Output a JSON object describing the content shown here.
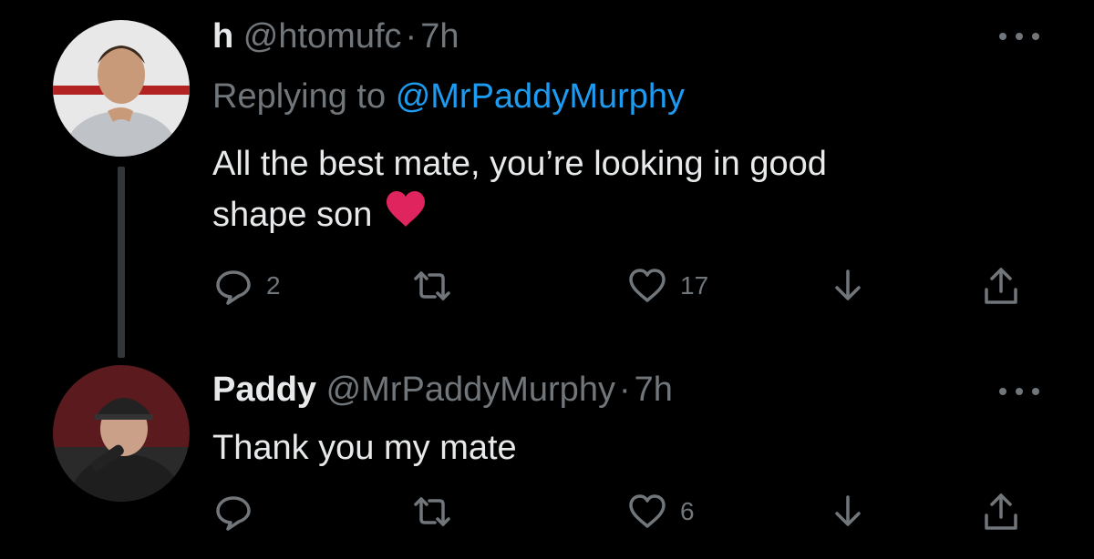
{
  "tweet1": {
    "display_name": "h",
    "handle": "@htomufc",
    "separator": "·",
    "time": "7h",
    "replying_prefix": "Replying to",
    "replying_to": "@MrPaddyMurphy",
    "text_line1": "All the best mate, you’re looking in good",
    "text_line2": "shape son",
    "emoji": "red-heart",
    "reply_count": "2",
    "retweet_count": "",
    "like_count": "17"
  },
  "tweet2": {
    "display_name": "Paddy",
    "handle": "@MrPaddyMurphy",
    "separator": "·",
    "time": "7h",
    "text_line1": "Thank you my mate",
    "reply_count": "",
    "retweet_count": "",
    "like_count": "6"
  },
  "icons": {
    "reply": "speech-bubble-icon",
    "retweet": "retweet-icon",
    "like": "heart-outline-icon",
    "download": "arrow-down-icon",
    "share": "share-icon",
    "more": "more-dots-icon"
  },
  "colors": {
    "background": "#000000",
    "text": "#e7e9ea",
    "secondary": "#71767b",
    "link": "#1d9bf0",
    "heart": "#e0245e"
  }
}
